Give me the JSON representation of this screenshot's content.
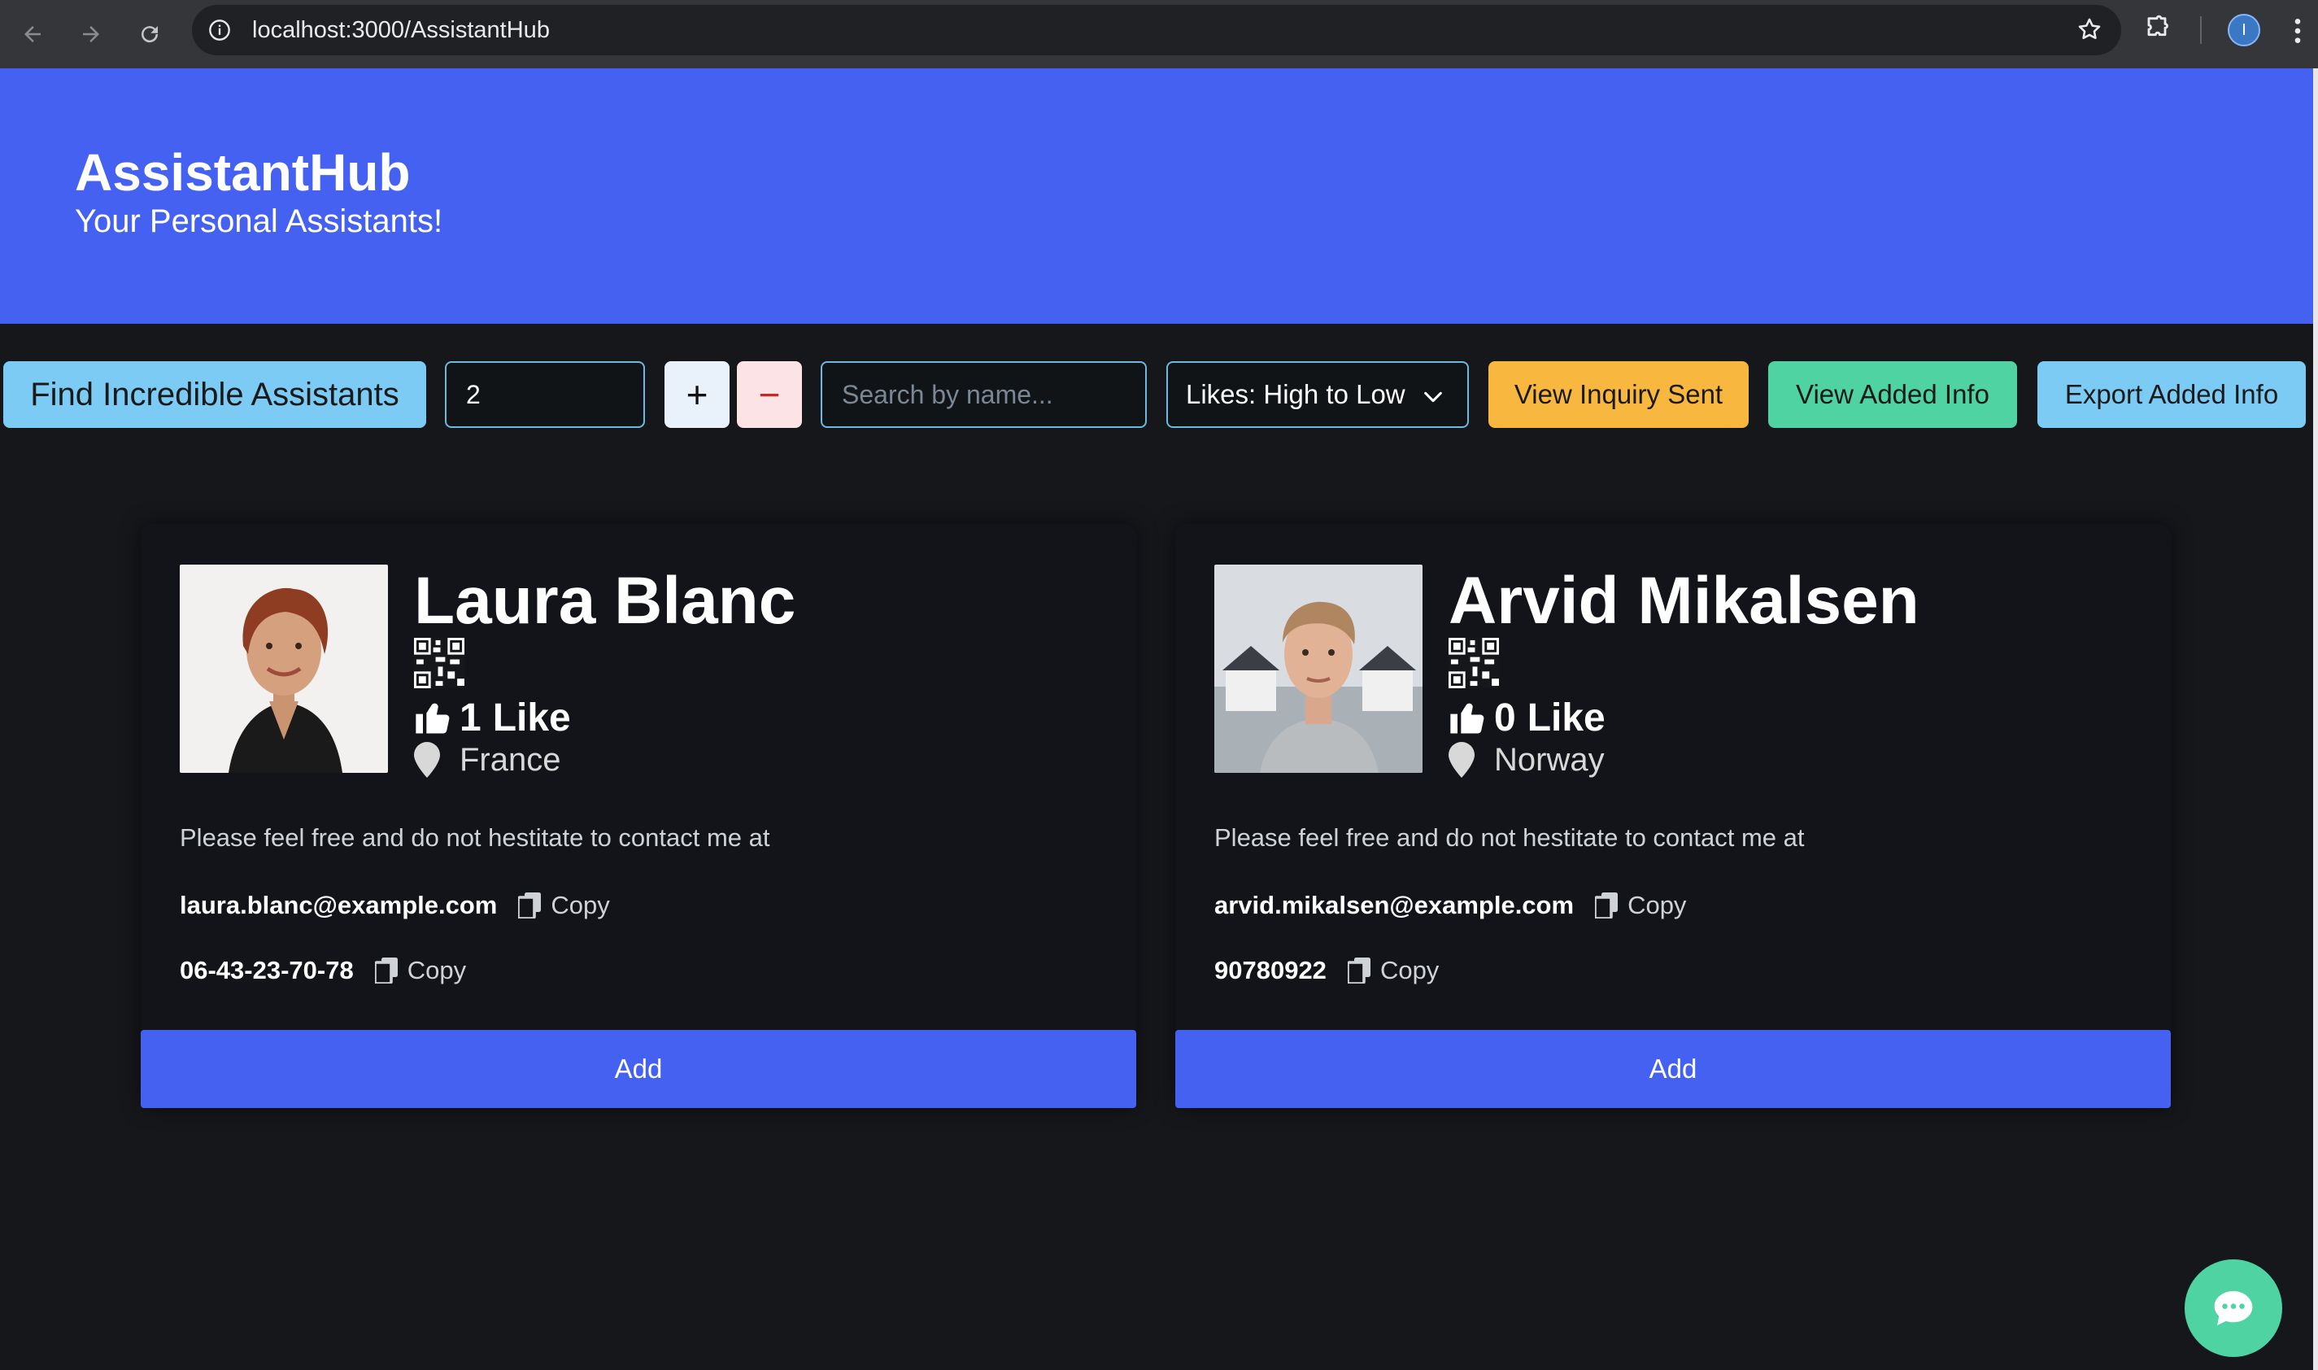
{
  "browser": {
    "url": "localhost:3000/AssistantHub",
    "profile_initial": "I"
  },
  "hero": {
    "title": "AssistantHub",
    "subtitle": "Your Personal Assistants!"
  },
  "controls": {
    "find_label": "Find Incredible Assistants",
    "count_value": "2",
    "plus_label": "+",
    "minus_label": "−",
    "search_placeholder": "Search by name...",
    "sort_selected": "Likes: High to Low",
    "inquiry_label": "View Inquiry Sent",
    "added_label": "View Added Info",
    "export_label": "Export Added Info"
  },
  "assistants": [
    {
      "name": "Laura Blanc",
      "likes_count": "1",
      "likes_word": "Like",
      "country": "France",
      "blurb": "Please feel free and do not hestitate to contact me at",
      "email": "laura.blanc@example.com",
      "phone": "06-43-23-70-78",
      "copy_label": "Copy",
      "add_label": "Add"
    },
    {
      "name": "Arvid Mikalsen",
      "likes_count": "0",
      "likes_word": "Like",
      "country": "Norway",
      "blurb": "Please feel free and do not hestitate to contact me at",
      "email": "arvid.mikalsen@example.com",
      "phone": "90780922",
      "copy_label": "Copy",
      "add_label": "Add"
    }
  ],
  "colors": {
    "brand_blue": "#4461f2",
    "page_bg": "#16171b",
    "card_bg": "#121419",
    "teal": "#4fd3a2",
    "amber": "#f8b73e",
    "sky": "#7ccbf4"
  },
  "icons": {
    "chat": "chat-bubble-icon",
    "thumb": "thumbs-up-icon",
    "pin": "map-pin-icon",
    "copy": "copy-icon",
    "qr": "qr-code-icon"
  }
}
